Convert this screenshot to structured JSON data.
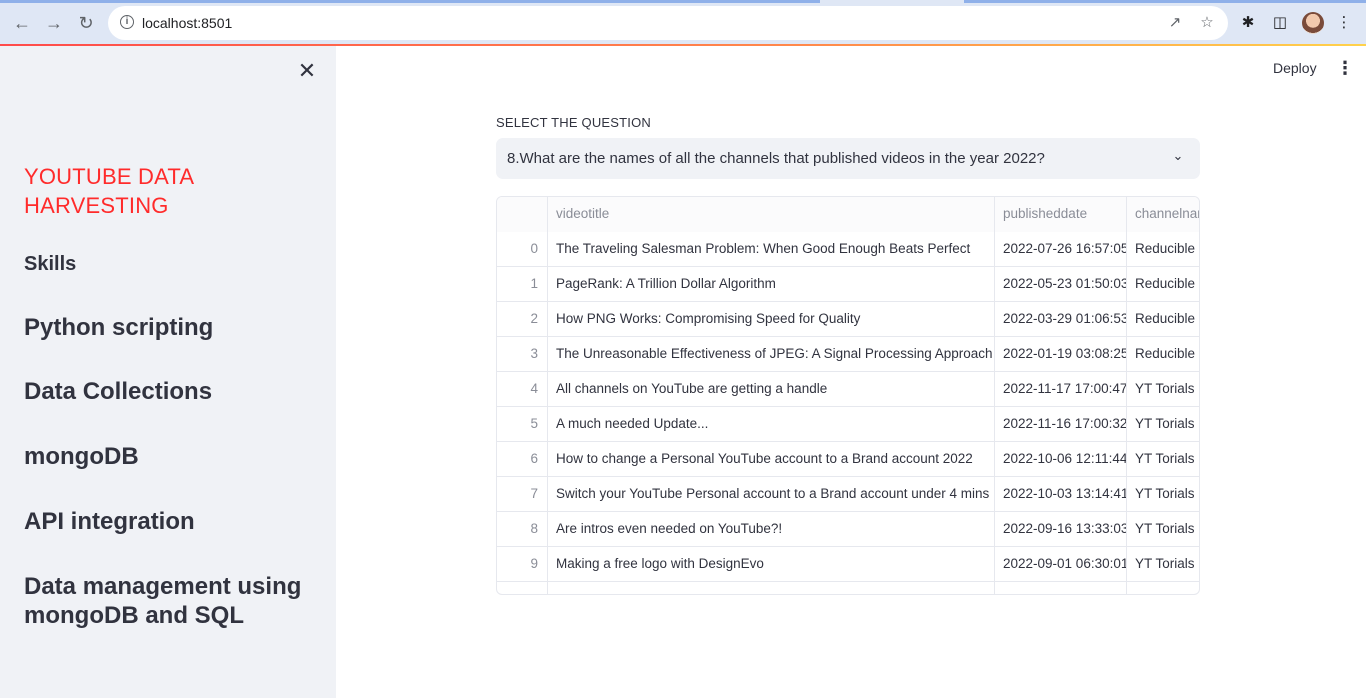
{
  "browser": {
    "url": "localhost:8501"
  },
  "sidebar": {
    "brand": "YOUTUBE DATA HARVESTING",
    "skills_heading": "Skills",
    "skills": [
      "Python scripting",
      "Data Collections",
      "mongoDB",
      "API integration",
      "Data management using mongoDB and SQL"
    ]
  },
  "header": {
    "deploy_label": "Deploy"
  },
  "question": {
    "label": "SELECT THE QUESTION",
    "selected": "8.What are the names of all the channels that published videos in the year 2022?"
  },
  "table": {
    "columns": [
      "",
      "videotitle",
      "publisheddate",
      "channelnar"
    ],
    "rows": [
      [
        "0",
        "The Traveling Salesman Problem: When Good Enough Beats Perfect",
        "2022-07-26 16:57:05",
        "Reducible"
      ],
      [
        "1",
        "PageRank: A Trillion Dollar Algorithm",
        "2022-05-23 01:50:03",
        "Reducible"
      ],
      [
        "2",
        "How PNG Works: Compromising Speed for Quality",
        "2022-03-29 01:06:53",
        "Reducible"
      ],
      [
        "3",
        "The Unreasonable Effectiveness of JPEG: A Signal Processing Approach",
        "2022-01-19 03:08:25",
        "Reducible"
      ],
      [
        "4",
        "All channels on YouTube are getting a handle",
        "2022-11-17 17:00:47",
        "YT Torials"
      ],
      [
        "5",
        "A much needed Update...",
        "2022-11-16 17:00:32",
        "YT Torials"
      ],
      [
        "6",
        "How to change a Personal YouTube account to a Brand account 2022",
        "2022-10-06 12:11:44",
        "YT Torials"
      ],
      [
        "7",
        "Switch your YouTube Personal account to a Brand account under 4 mins",
        "2022-10-03 13:14:41",
        "YT Torials"
      ],
      [
        "8",
        "Are intros even needed on YouTube?!",
        "2022-09-16 13:33:03",
        "YT Torials"
      ],
      [
        "9",
        "Making a free logo with DesignEvo",
        "2022-09-01 06:30:01",
        "YT Torials"
      ]
    ]
  }
}
